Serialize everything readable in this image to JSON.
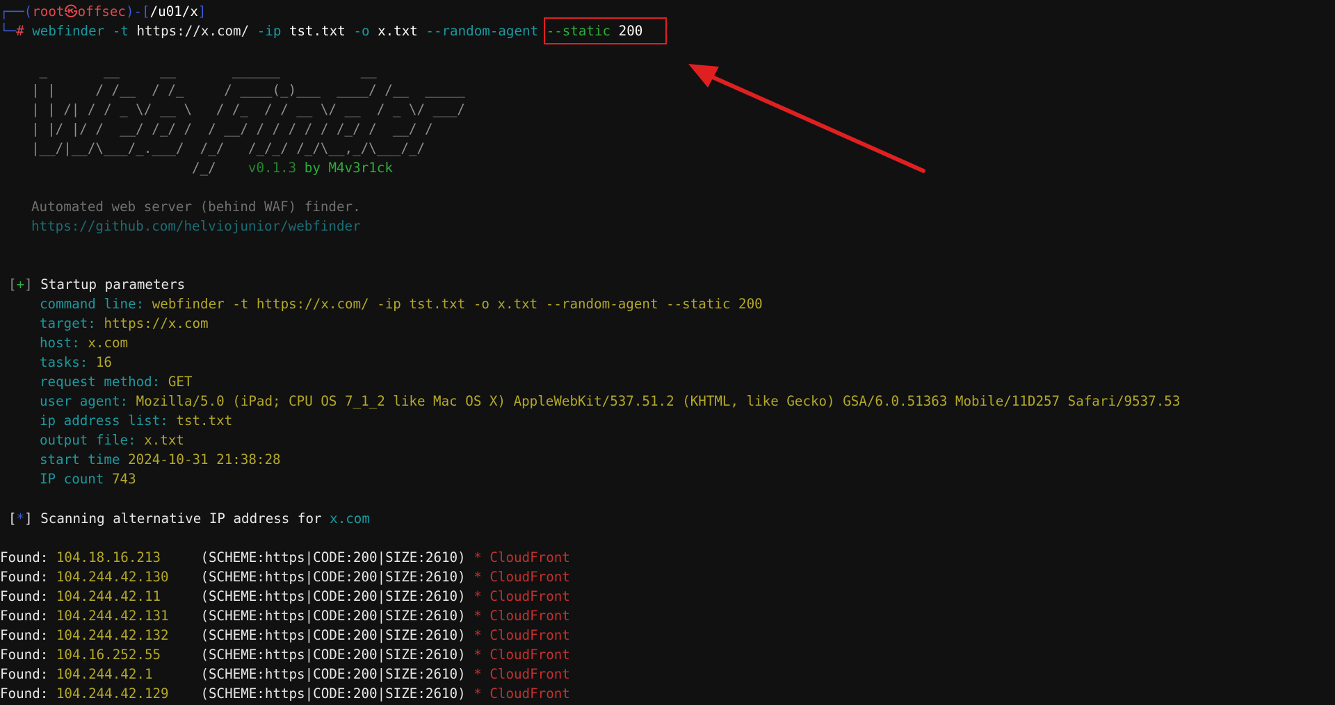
{
  "prompt": {
    "corner_top": "┌──(",
    "user": "root",
    "at_symbol": "㉿",
    "host": "offsec",
    "sep": ")-[",
    "path": "/u01/x",
    "close": "]",
    "corner_bottom": "└─",
    "hash": "#"
  },
  "command": {
    "program": "webfinder",
    "flag_t": "-t",
    "target_url": "https://x.com/",
    "flag_ip": "-ip",
    "ip_file": "tst.txt",
    "flag_o": "-o",
    "out_file": "x.txt",
    "flag_random": "--random-agent",
    "flag_static": "--static",
    "static_value": "200"
  },
  "banner": {
    "art": [
      " _       __     __       ______          __",
      "| |     / /__  / /_     / ____(_)___  ____/ /__  _____",
      "| | /| / / _ \\/ __ \\   / /_  / / __ \\/ __  / _ \\/ ___/",
      "| |/ |/ /  __/ /_/ /  / __/ / / / / / /_/ /  __/ /",
      "|__/|__/\\___/_.___/  /_/   /_/_/ /_/\\__,_/\\___/_/",
      "                    /_/"
    ],
    "version": "v0.1.3",
    "by_text": "by M4v3r1ck",
    "description": "Automated web server (behind WAF) finder.",
    "repo_url": "https://github.com/helviojunior/webfinder"
  },
  "startup": {
    "marker_open": "[",
    "marker_plus": "+",
    "marker_close": "]",
    "title": "Startup parameters",
    "params": [
      {
        "key": "command line:",
        "value": "webfinder -t https://x.com/ -ip tst.txt -o x.txt --random-agent --static 200"
      },
      {
        "key": "target:",
        "value": "https://x.com"
      },
      {
        "key": "host:",
        "value": "x.com"
      },
      {
        "key": "tasks:",
        "value": "16"
      },
      {
        "key": "request method:",
        "value": "GET"
      },
      {
        "key": "user agent:",
        "value": "Mozilla/5.0 (iPad; CPU OS 7_1_2 like Mac OS X) AppleWebKit/537.51.2 (KHTML, like Gecko) GSA/6.0.51363 Mobile/11D257 Safari/9537.53"
      },
      {
        "key": "ip address list:",
        "value": "tst.txt"
      },
      {
        "key": "output file:",
        "value": "x.txt"
      },
      {
        "key": "start time",
        "value": "2024-10-31 21:38:28"
      },
      {
        "key": "IP count",
        "value": "743"
      }
    ]
  },
  "scan": {
    "marker_open": "[",
    "marker_star": "*",
    "marker_close": "]",
    "text": "Scanning alternative IP address for",
    "host": "x.com"
  },
  "results": [
    {
      "label": "Found:",
      "ip": "104.18.16.213",
      "info": "(SCHEME:https|CODE:200|SIZE:2610)",
      "star": "*",
      "provider": "CloudFront"
    },
    {
      "label": "Found:",
      "ip": "104.244.42.130",
      "info": "(SCHEME:https|CODE:200|SIZE:2610)",
      "star": "*",
      "provider": "CloudFront"
    },
    {
      "label": "Found:",
      "ip": "104.244.42.11",
      "info": "(SCHEME:https|CODE:200|SIZE:2610)",
      "star": "*",
      "provider": "CloudFront"
    },
    {
      "label": "Found:",
      "ip": "104.244.42.131",
      "info": "(SCHEME:https|CODE:200|SIZE:2610)",
      "star": "*",
      "provider": "CloudFront"
    },
    {
      "label": "Found:",
      "ip": "104.244.42.132",
      "info": "(SCHEME:https|CODE:200|SIZE:2610)",
      "star": "*",
      "provider": "CloudFront"
    },
    {
      "label": "Found:",
      "ip": "104.16.252.55",
      "info": "(SCHEME:https|CODE:200|SIZE:2610)",
      "star": "*",
      "provider": "CloudFront"
    },
    {
      "label": "Found:",
      "ip": "104.244.42.1",
      "info": "(SCHEME:https|CODE:200|SIZE:2610)",
      "star": "*",
      "provider": "CloudFront"
    },
    {
      "label": "Found:",
      "ip": "104.244.42.129",
      "info": "(SCHEME:https|CODE:200|SIZE:2610)",
      "star": "*",
      "provider": "CloudFront"
    }
  ],
  "colors": {
    "background": "#111111",
    "annotation_red": "#e02020"
  }
}
